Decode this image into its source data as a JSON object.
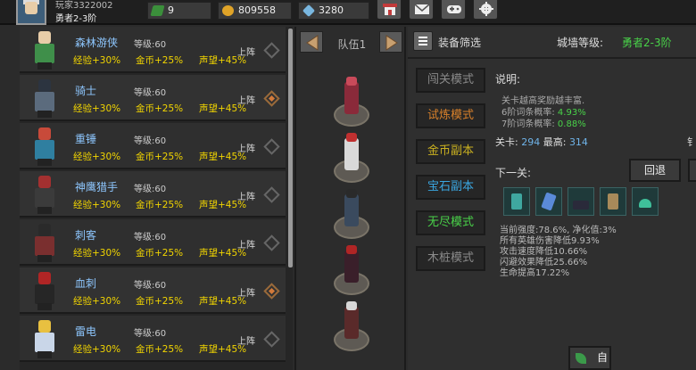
{
  "player": {
    "name": "玩家3322002",
    "rank": "勇者2-3阶"
  },
  "resources": {
    "energy": "9",
    "gold": "809558",
    "gems": "3280"
  },
  "toolbar": {
    "icons": [
      "shop-icon",
      "mail-icon",
      "gamepad-icon",
      "settings-icon"
    ]
  },
  "heroes": [
    {
      "name": "森林游侠",
      "level": "等级:60",
      "exp": "经验+30%",
      "gold": "金币+25%",
      "fame": "声望+45%",
      "deploy": "上阵",
      "selected": false,
      "color": "#3f8f4a",
      "head": "#e8cda8"
    },
    {
      "name": "骑士",
      "level": "等级:60",
      "exp": "经验+30%",
      "gold": "金币+25%",
      "fame": "声望+45%",
      "deploy": "上阵",
      "selected": true,
      "color": "#5b6b7d",
      "head": "#2c3440"
    },
    {
      "name": "重锤",
      "level": "等级:60",
      "exp": "经验+30%",
      "gold": "金币+25%",
      "fame": "声望+45%",
      "deploy": "上阵",
      "selected": false,
      "color": "#2f7fa0",
      "head": "#c84a3a"
    },
    {
      "name": "神鹰猎手",
      "level": "等级:60",
      "exp": "经验+30%",
      "gold": "金币+25%",
      "fame": "声望+45%",
      "deploy": "上阵",
      "selected": false,
      "color": "#3b3b3b",
      "head": "#a33030"
    },
    {
      "name": "刺客",
      "level": "等级:60",
      "exp": "经验+30%",
      "gold": "金币+25%",
      "fame": "声望+45%",
      "deploy": "上阵",
      "selected": false,
      "color": "#7a2f2f",
      "head": "#2a2a2a"
    },
    {
      "name": "血刺",
      "level": "等级:60",
      "exp": "经验+30%",
      "gold": "金币+25%",
      "fame": "声望+45%",
      "deploy": "上阵",
      "selected": true,
      "color": "#262626",
      "head": "#b02525"
    },
    {
      "name": "雷电",
      "level": "等级:60",
      "exp": "经验+30%",
      "gold": "金币+25%",
      "fame": "声望+45%",
      "deploy": "上阵",
      "selected": false,
      "color": "#c9d6e8",
      "head": "#e8c040"
    }
  ],
  "team": {
    "label": "队伍1",
    "members": [
      {
        "body": "#8a2a3a",
        "head": "#c94a5a"
      },
      {
        "body": "#d9d9d9",
        "head": "#c03030"
      },
      {
        "body": "#3a4a5e",
        "head": "#2a2a2a"
      },
      {
        "body": "#3a1f2a",
        "head": "#b02525"
      },
      {
        "body": "#5a2a2a",
        "head": "#d8d8d8"
      }
    ]
  },
  "panel": {
    "filter_label": "装备筛选",
    "wall_label": "城墙等级:",
    "wall_value": "勇者2-3阶",
    "modes": [
      {
        "label": "闯关模式",
        "color": "#8a8a8a"
      },
      {
        "label": "试炼模式",
        "color": "#d8802a"
      },
      {
        "label": "金币副本",
        "color": "#c9b020"
      },
      {
        "label": "宝石副本",
        "color": "#3aa6e0"
      },
      {
        "label": "无尽模式",
        "color": "#49d249"
      },
      {
        "label": "木桩模式",
        "color": "#8a8a8a"
      }
    ],
    "desc_title": "说明:",
    "desc_line1": "关卡越高奖励越丰富.",
    "desc_line2_label": "6阶词条概率:",
    "desc_line2_value": "4.93%",
    "desc_line3_label": "7阶词条概率:",
    "desc_line3_value": "0.88%",
    "stage_label": "关卡:",
    "stage_value": "294",
    "best_label": "最高:",
    "best_value": "314",
    "edge_text": "钅",
    "next_label": "下一关:",
    "back_label": "回退",
    "enemy_icons": [
      "teal-warrior-icon",
      "ice-mage-icon",
      "shadow-beast-icon",
      "armored-knight-icon",
      "slime-icon"
    ],
    "bonuses": [
      "当前强度:78.6%, 净化值:3%",
      "所有英雄伤害降低9.93%",
      "攻击速度降低10.66%",
      "闪避效果降低25.66%",
      "生命提高17.22%"
    ],
    "auto_label": "自"
  }
}
